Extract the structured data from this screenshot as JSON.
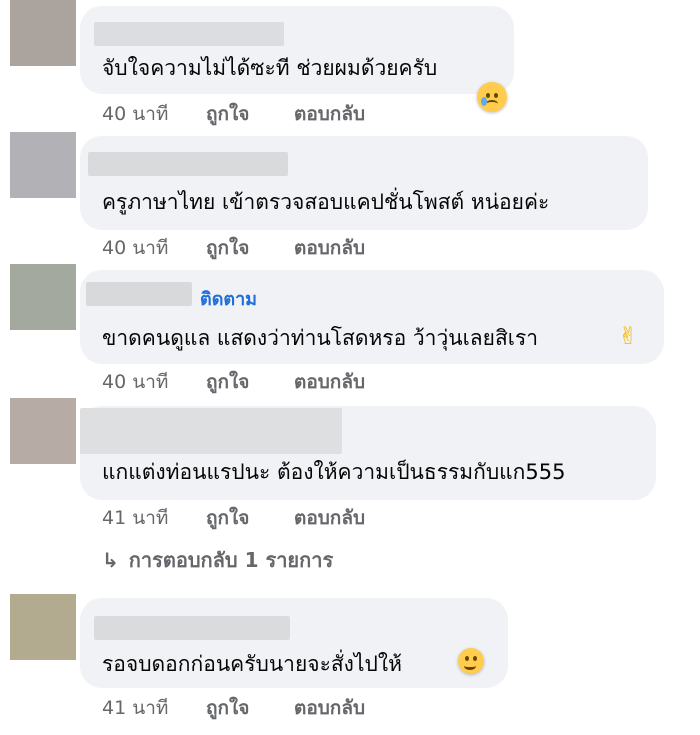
{
  "comments": [
    {
      "text": "จับใจความไม่ได้ซะที ช่วยผมด้วยครับ",
      "time": "40 นาที",
      "like": "ถูกใจ",
      "reply": "ตอบกลับ"
    },
    {
      "text": "ครูภาษาไทย เข้าตรวจสอบแคปชั่นโพสต์ หน่อยค่ะ",
      "time": "40 นาที",
      "like": "ถูกใจ",
      "reply": "ตอบกลับ"
    },
    {
      "follow": "ติดตาม",
      "text": "ขาดคนดูแล แสดงว่าท่านโสดหรอ ว้าวุ่นเลยสิเรา",
      "time": "40 นาที",
      "like": "ถูกใจ",
      "reply": "ตอบกลับ"
    },
    {
      "text": "แกแต่งท่อนแรปนะ ต้องให้ความเป็นธรรมกับแก555",
      "time": "41 นาที",
      "like": "ถูกใจ",
      "reply": "ตอบกลับ"
    },
    {
      "text": "รอจบดอกก่อนครับนายจะสั่งไปให้",
      "time": "41 นาที",
      "like": "ถูกใจ",
      "reply": "ตอบกลับ"
    }
  ],
  "view_replies": "การตอบกลับ 1 รายการ",
  "icons": {
    "reaction_1": "crying-face-icon",
    "reaction_3": "victory-hand-icon",
    "reaction_5": "grinning-sweat-icon",
    "reply_arrow": "reply-arrow-icon"
  },
  "colors": {
    "bubble": "#f0f2f5",
    "meta_text": "#65676b",
    "follow_link": "#216fdb",
    "avatar_1": "#aba49e",
    "avatar_2": "#b2b1b6",
    "avatar_3": "#a3a99f",
    "avatar_4": "#b6aba5",
    "avatar_5": "#b3ab90"
  }
}
